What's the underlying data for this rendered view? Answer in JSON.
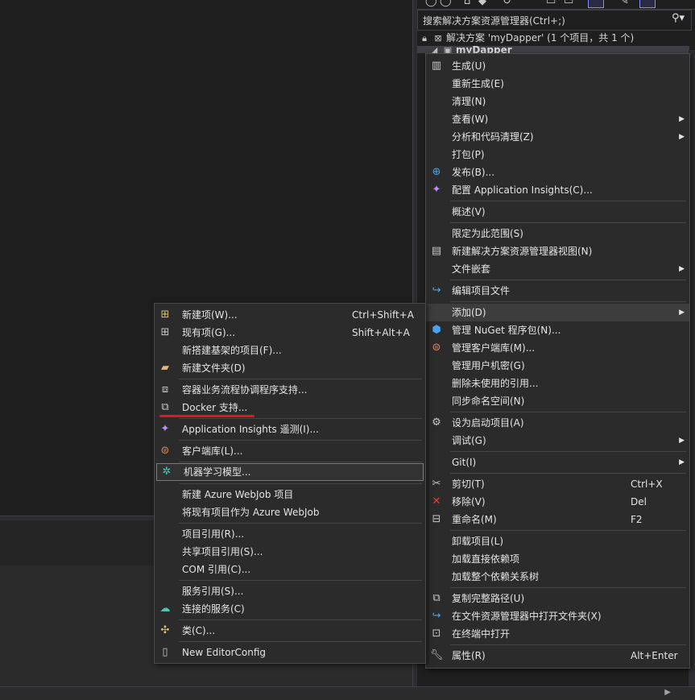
{
  "solution_explorer": {
    "search_placeholder": "搜索解决方案资源管理器(Ctrl+;)",
    "solution_label": "解决方案 'myDapper' (1 个项目，共 1 个)",
    "project_label": "myDapper"
  },
  "project_menu": {
    "items": [
      {
        "label": "生成(U)",
        "icon": "build-icon"
      },
      {
        "label": "重新生成(E)"
      },
      {
        "label": "清理(N)"
      },
      {
        "label": "查看(W)",
        "submenu": true
      },
      {
        "label": "分析和代码清理(Z)",
        "submenu": true
      },
      {
        "label": "打包(P)"
      },
      {
        "label": "发布(B)...",
        "icon": "globe-publish-icon"
      },
      {
        "label": "配置 Application Insights(C)...",
        "icon": "insights-icon"
      },
      {
        "label": "概述(V)"
      },
      {
        "label": "限定为此范围(S)"
      },
      {
        "label": "新建解决方案资源管理器视图(N)",
        "icon": "new-view-icon"
      },
      {
        "label": "文件嵌套",
        "submenu": true
      },
      {
        "label": "编辑项目文件",
        "icon": "redo-arrow-icon"
      },
      {
        "label": "添加(D)",
        "submenu": true,
        "highlighted": true
      },
      {
        "label": "管理 NuGet 程序包(N)...",
        "icon": "nuget-icon"
      },
      {
        "label": "管理客户端库(M)...",
        "icon": "client-library-icon"
      },
      {
        "label": "管理用户机密(G)"
      },
      {
        "label": "删除未使用的引用..."
      },
      {
        "label": "同步命名空间(N)"
      },
      {
        "label": "设为启动项目(A)",
        "icon": "gear-icon"
      },
      {
        "label": "调试(G)",
        "submenu": true
      },
      {
        "label": "Git(I)",
        "submenu": true
      },
      {
        "label": "剪切(T)",
        "shortcut": "Ctrl+X",
        "icon": "scissors-icon"
      },
      {
        "label": "移除(V)",
        "shortcut": "Del",
        "icon": "remove-x-icon"
      },
      {
        "label": "重命名(M)",
        "shortcut": "F2",
        "icon": "rename-icon"
      },
      {
        "label": "卸载项目(L)"
      },
      {
        "label": "加载直接依赖项"
      },
      {
        "label": "加载整个依赖关系树"
      },
      {
        "label": "复制完整路径(U)",
        "icon": "copy-icon"
      },
      {
        "label": "在文件资源管理器中打开文件夹(X)",
        "icon": "open-folder-arrow-icon"
      },
      {
        "label": "在终端中打开",
        "icon": "terminal-icon"
      },
      {
        "label": "属性(R)",
        "shortcut": "Alt+Enter",
        "icon": "wrench-icon"
      }
    ]
  },
  "add_submenu": {
    "items": [
      {
        "label": "新建项(W)...",
        "shortcut": "Ctrl+Shift+A",
        "icon": "new-item-icon"
      },
      {
        "label": "现有项(G)...",
        "shortcut": "Shift+Alt+A",
        "icon": "existing-item-icon"
      },
      {
        "label": "新搭建基架的项目(F)..."
      },
      {
        "label": "新建文件夹(D)",
        "icon": "new-folder-icon"
      },
      {
        "label": "容器业务流程协调程序支持...",
        "icon": "container-orchestration-icon"
      },
      {
        "label": "Docker 支持...",
        "icon": "docker-icon"
      },
      {
        "label": "Application Insights 遥测(I)...",
        "icon": "insights-icon"
      },
      {
        "label": "客户端库(L)...",
        "icon": "client-library-icon"
      },
      {
        "label": "机器学习模型...",
        "icon": "ml-model-icon",
        "highlighted": true
      },
      {
        "label": "新建 Azure WebJob 项目"
      },
      {
        "label": "将现有项目作为 Azure WebJob"
      },
      {
        "label": "项目引用(R)..."
      },
      {
        "label": "共享项目引用(S)..."
      },
      {
        "label": "COM 引用(C)..."
      },
      {
        "label": "服务引用(S)..."
      },
      {
        "label": "连接的服务(C)",
        "icon": "connected-service-icon"
      },
      {
        "label": "类(C)...",
        "icon": "class-icon"
      },
      {
        "label": "New EditorConfig",
        "icon": "file-icon"
      }
    ]
  },
  "colors": {
    "annotation_underline": "#e0181f",
    "highlight": "#3d3d3d",
    "menu_bg": "#2b2b2b"
  }
}
